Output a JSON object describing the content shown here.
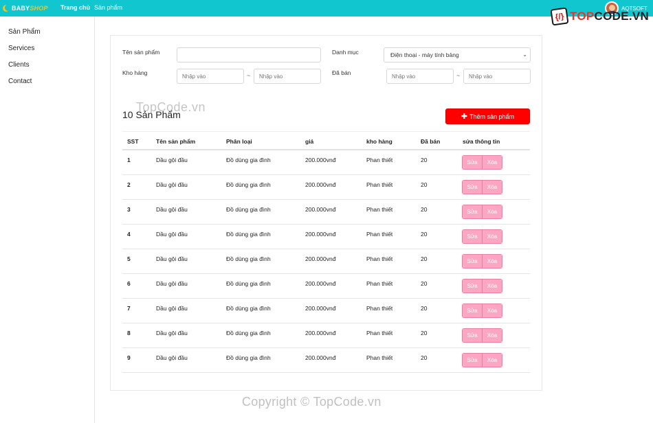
{
  "header": {
    "logo_part1": "BABY",
    "logo_part2": "SHOP",
    "nav": [
      "Trang chủ",
      "Sản phẩm"
    ],
    "username": "AQTSOFT",
    "brand_icon_text": "{/}",
    "brand_text_a": "TOP",
    "brand_text_b": "CODE.VN"
  },
  "sidebar": {
    "items": [
      "Sản Phẩm",
      "Services",
      "Clients",
      "Contact"
    ]
  },
  "filters": {
    "name_label": "Tên sản phẩm",
    "name_value": "",
    "category_label": "Danh mục",
    "category_value": "Điện thoại - máy tính bảng",
    "stock_label": "Kho hàng",
    "stock_from_placeholder": "Nhập vào",
    "stock_to_placeholder": "Nhập vào",
    "sold_label": "Đã bán",
    "sold_from_placeholder": "Nhập vào",
    "sold_to_placeholder": "Nhập vào",
    "range_separator": "~"
  },
  "summary": {
    "title": "10 Sản Phẩm",
    "add_button": "Thêm sản phẩm"
  },
  "table": {
    "headers": [
      "SST",
      "Tên sản phẩm",
      "Phân loại",
      "giá",
      "kho hàng",
      "Đã bán",
      "sửa thông tin"
    ],
    "edit_label": "Sửa",
    "delete_label": "Xóa",
    "rows": [
      {
        "stt": "1",
        "name": "Dầu gội đầu",
        "type": "Đồ dùng gia đình",
        "price": "200.000vnđ",
        "warehouse": "Phan thiết",
        "sold": "20"
      },
      {
        "stt": "2",
        "name": "Dầu gội đầu",
        "type": "Đồ dùng gia đình",
        "price": "200.000vnđ",
        "warehouse": "Phan thiết",
        "sold": "20"
      },
      {
        "stt": "3",
        "name": "Dầu gội đầu",
        "type": "Đồ dùng gia đình",
        "price": "200.000vnđ",
        "warehouse": "Phan thiết",
        "sold": "20"
      },
      {
        "stt": "4",
        "name": "Dầu gội đầu",
        "type": "Đồ dùng gia đình",
        "price": "200.000vnđ",
        "warehouse": "Phan thiết",
        "sold": "20"
      },
      {
        "stt": "5",
        "name": "Dầu gội đầu",
        "type": "Đồ dùng gia đình",
        "price": "200.000vnđ",
        "warehouse": "Phan thiết",
        "sold": "20"
      },
      {
        "stt": "6",
        "name": "Dầu gội đầu",
        "type": "Đồ dùng gia đình",
        "price": "200.000vnđ",
        "warehouse": "Phan thiết",
        "sold": "20"
      },
      {
        "stt": "7",
        "name": "Dầu gội đầu",
        "type": "Đồ dùng gia đình",
        "price": "200.000vnđ",
        "warehouse": "Phan thiết",
        "sold": "20"
      },
      {
        "stt": "8",
        "name": "Dầu gội đầu",
        "type": "Đồ dùng gia đình",
        "price": "200.000vnđ",
        "warehouse": "Phan thiết",
        "sold": "20"
      },
      {
        "stt": "9",
        "name": "Dầu gội đầu",
        "type": "Đồ dùng gia đình",
        "price": "200.000vnđ",
        "warehouse": "Phan thiết",
        "sold": "20"
      }
    ]
  },
  "watermarks": {
    "mid": "TopCode.vn",
    "footer": "Copyright © TopCode.vn"
  }
}
